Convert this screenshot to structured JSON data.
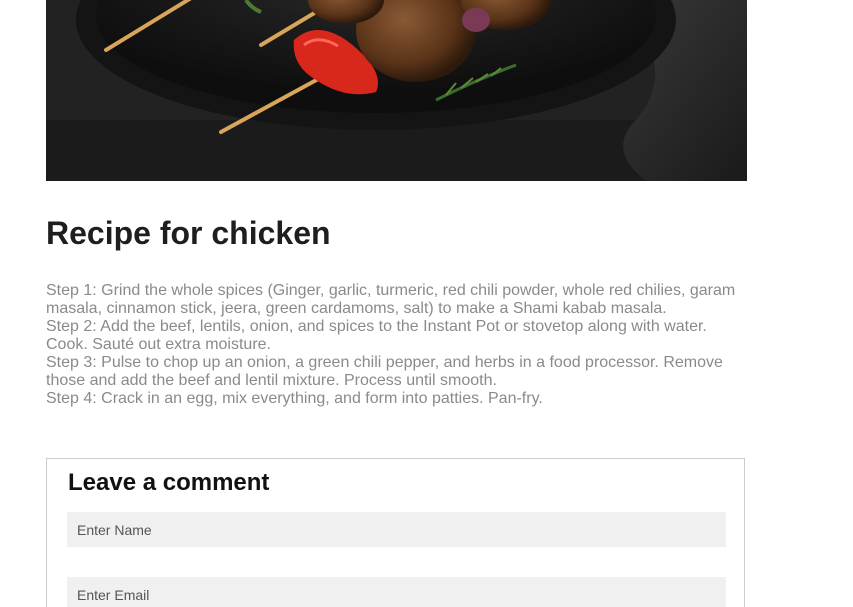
{
  "hero": {
    "image_name": "grilled-kebab-skewers-photo"
  },
  "recipe": {
    "title": "Recipe for chicken",
    "steps": [
      "Step 1: Grind the whole spices (Ginger, garlic, turmeric, red chili powder, whole red chilies, garam masala, cinnamon stick, jeera, green cardamoms, salt) to make a Shami kabab masala.",
      "Step 2: Add the beef, lentils, onion, and spices to the Instant Pot or stovetop along with water. Cook. Sauté out extra moisture.",
      "Step 3: Pulse to chop up an onion, a green chili pepper, and herbs in a food processor. Remove those and add the beef and lentil mixture. Process until smooth.",
      "Step 4: Crack in an egg, mix everything, and form into patties. Pan-fry."
    ]
  },
  "comment": {
    "title": "Leave a comment",
    "name_placeholder": "Enter Name",
    "email_placeholder": "Enter Email"
  },
  "colors": {
    "title": "#1e1e1e",
    "body_text": "#8a8a8a",
    "field_bg": "#f0f0f0",
    "border": "#cccccc"
  }
}
